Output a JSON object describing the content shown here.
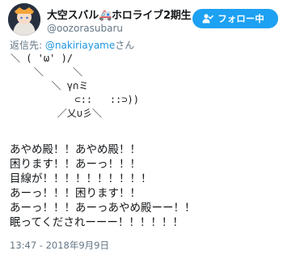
{
  "user": {
    "display_name": "大空スバル🚑ホロライブ2期生",
    "handle": "@oozorasubaru"
  },
  "follow_button": {
    "label": "フォロー中"
  },
  "reply": {
    "prefix": "返信先: ",
    "mention": "@nakiriayame",
    "suffix": "さん"
  },
  "ascii_art": "＼ ( 'ω' )/\n    ＼     ＼\n       ＼ γ∩ミ\n           ⊂::   ::⊃))\n        ／乂∪彡＼",
  "body_lines": [
    "あやめ殿！！あやめ殿！！",
    "困ります！！あーっ！！！",
    "目線が！！！！！！！！！！",
    "あーっ！！！困ります！！",
    "あーっ！！！あーっあやめ殿ーー！！",
    "眠ってくだされーーー！！！！！！"
  ],
  "timestamp": "13:47 - 2018年9月9日",
  "colors": {
    "accent": "#1da1f2",
    "mention": "#1b95e0",
    "secondary_text": "#657786"
  }
}
